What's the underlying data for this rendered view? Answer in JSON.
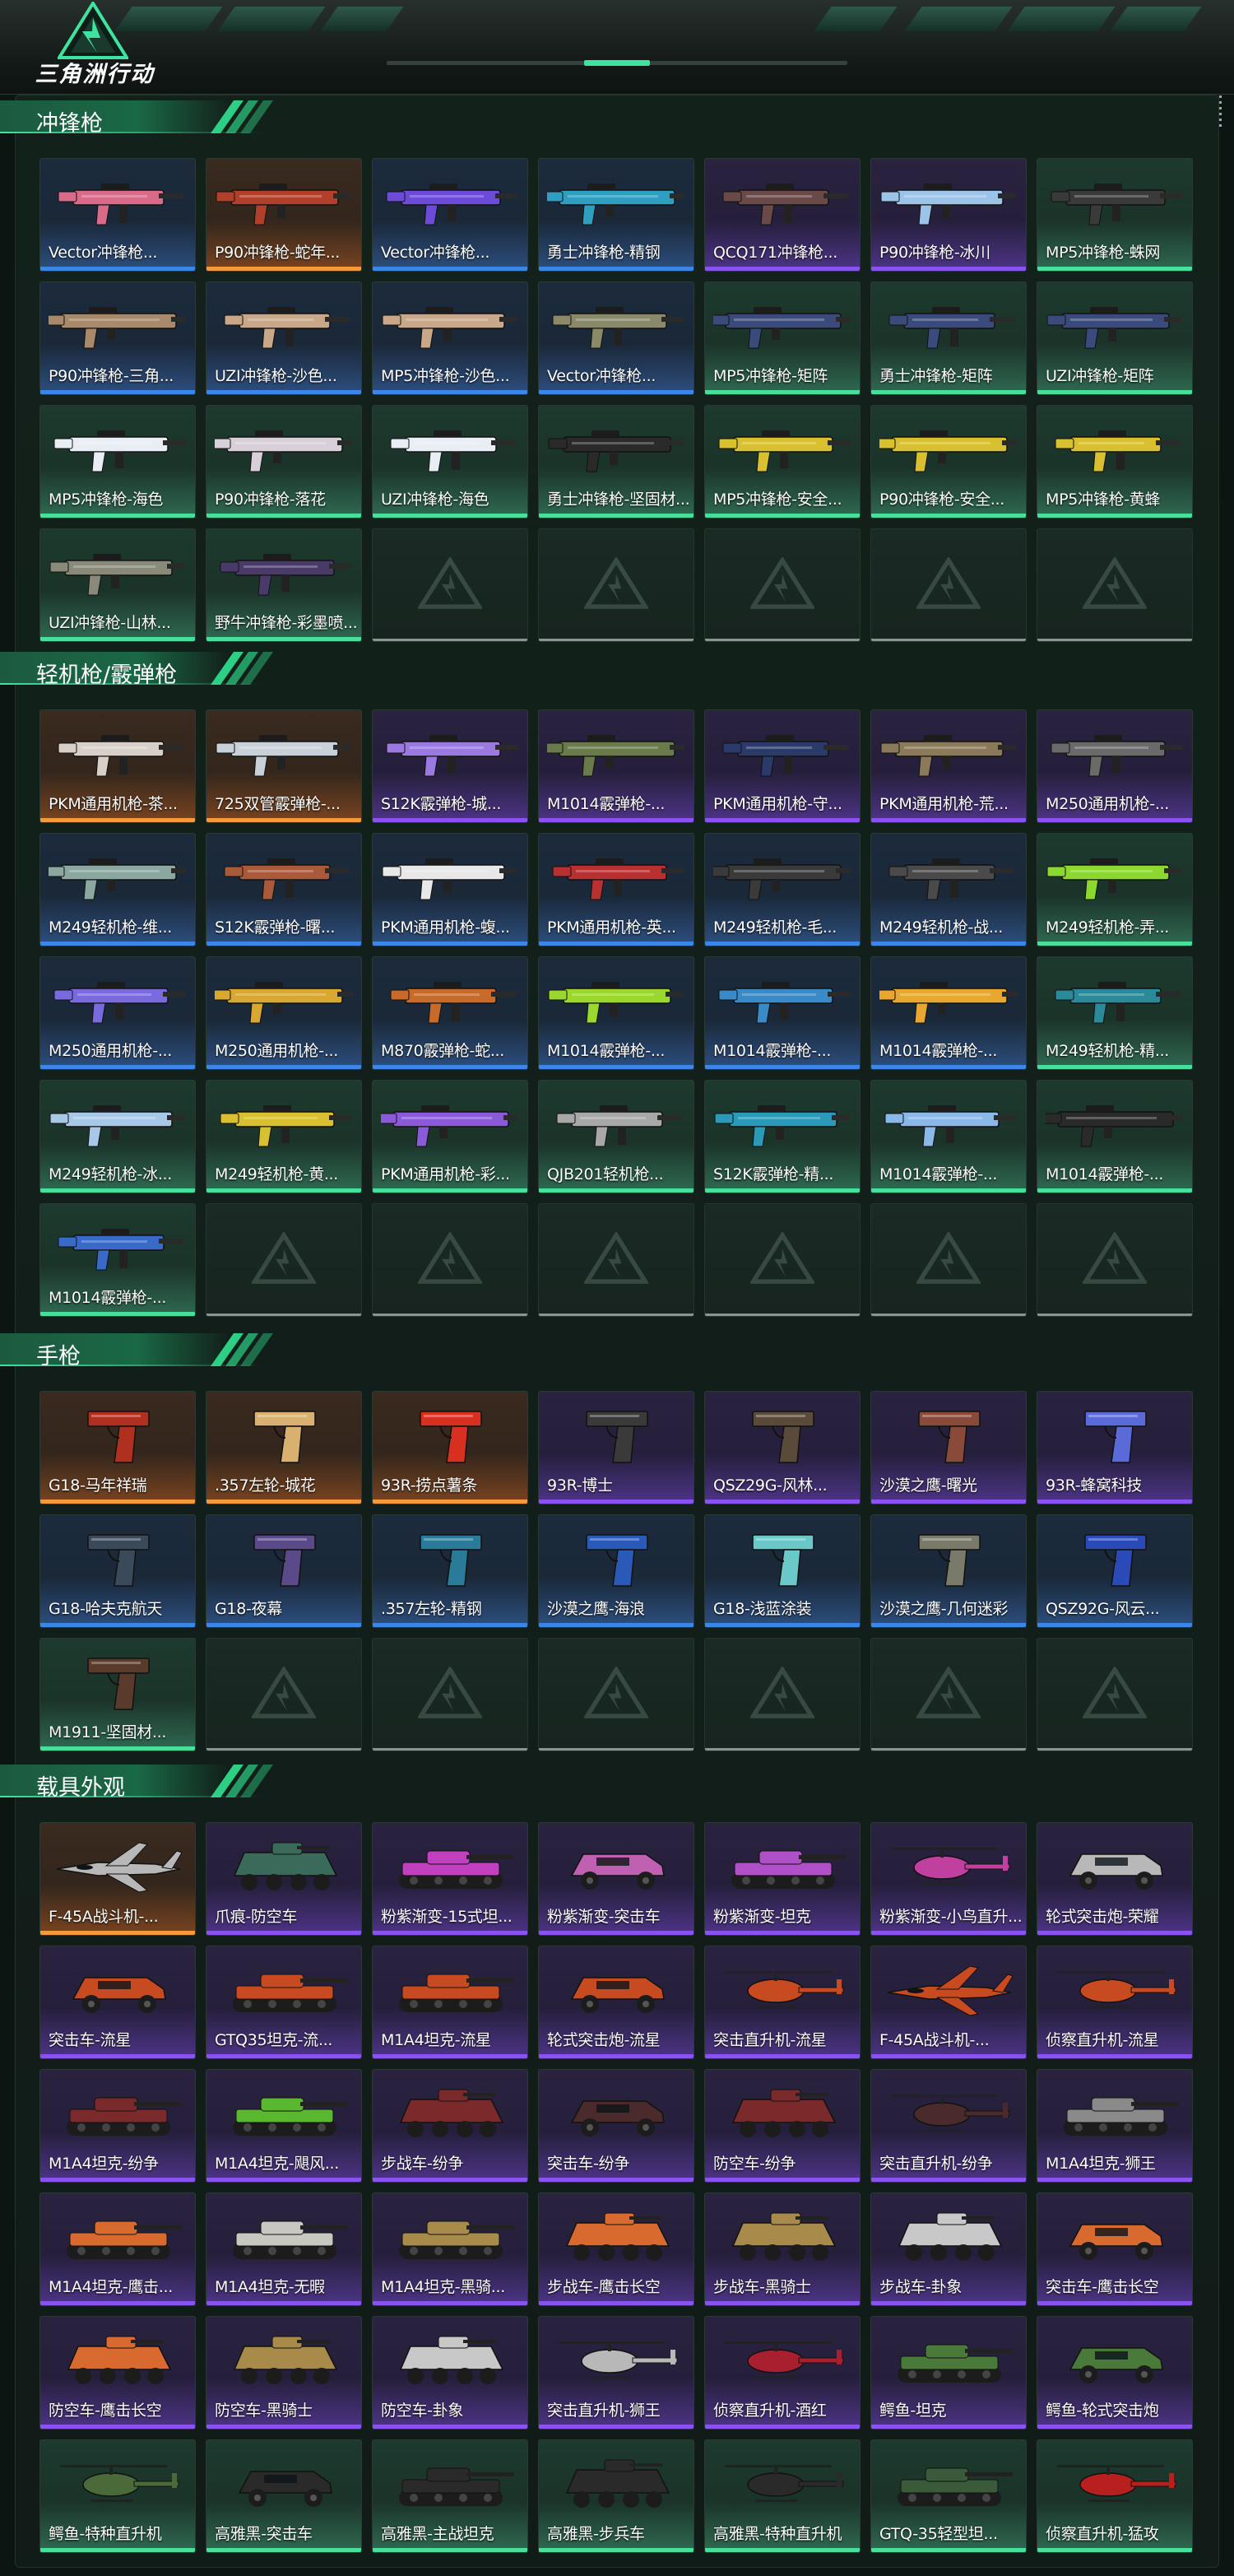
{
  "app": {
    "title": "三角洲行动",
    "logo_icon": "delta-triangle-logo-icon",
    "accent": "#2ccf84"
  },
  "rarity_colors": {
    "green": "#46e09a",
    "blue": "#3b86e8",
    "purple": "#8a52f0",
    "orange": "#f39a3c"
  },
  "sections": [
    {
      "id": "smg",
      "title": "冲锋枪",
      "kind": "gun",
      "items": [
        {
          "label": "Vector冲锋枪...",
          "rarity": "blue",
          "color": "#d86a8a"
        },
        {
          "label": "P90冲锋枪-蛇年...",
          "rarity": "orange",
          "color": "#b0402a"
        },
        {
          "label": "Vector冲锋枪...",
          "rarity": "blue",
          "color": "#6b4bd8"
        },
        {
          "label": "勇士冲锋枪-精钢",
          "rarity": "blue",
          "color": "#2f9ec0"
        },
        {
          "label": "QCQ171冲锋枪...",
          "rarity": "purple",
          "color": "#6a4a48"
        },
        {
          "label": "P90冲锋枪-冰川",
          "rarity": "purple",
          "color": "#9cc3e8"
        },
        {
          "label": "MP5冲锋枪-蛛网",
          "rarity": "green",
          "color": "#3a3a3a"
        },
        {
          "label": "P90冲锋枪-三角...",
          "rarity": "blue",
          "color": "#a88a6a"
        },
        {
          "label": "UZI冲锋枪-沙色...",
          "rarity": "blue",
          "color": "#c8a888"
        },
        {
          "label": "MP5冲锋枪-沙色...",
          "rarity": "blue",
          "color": "#c8a888"
        },
        {
          "label": "Vector冲锋枪...",
          "rarity": "blue",
          "color": "#8a8a6a"
        },
        {
          "label": "MP5冲锋枪-矩阵",
          "rarity": "green",
          "color": "#3a4a7a"
        },
        {
          "label": "勇士冲锋枪-矩阵",
          "rarity": "green",
          "color": "#3a4a7a"
        },
        {
          "label": "UZI冲锋枪-矩阵",
          "rarity": "green",
          "color": "#3a4a7a"
        },
        {
          "label": "MP5冲锋枪-海色",
          "rarity": "green",
          "color": "#e8eef4"
        },
        {
          "label": "P90冲锋枪-落花",
          "rarity": "green",
          "color": "#d8d0d8"
        },
        {
          "label": "UZI冲锋枪-海色",
          "rarity": "green",
          "color": "#e8eef4"
        },
        {
          "label": "勇士冲锋枪-坚固材...",
          "rarity": "green",
          "color": "#2a2a2a"
        },
        {
          "label": "MP5冲锋枪-安全...",
          "rarity": "green",
          "color": "#d8c030"
        },
        {
          "label": "P90冲锋枪-安全...",
          "rarity": "green",
          "color": "#d8c030"
        },
        {
          "label": "MP5冲锋枪-黄蜂",
          "rarity": "green",
          "color": "#d8c030"
        },
        {
          "label": "UZI冲锋枪-山林...",
          "rarity": "green",
          "color": "#8a8a7a"
        },
        {
          "label": "野牛冲锋枪-彩墨喷...",
          "rarity": "green",
          "color": "#4a3a6a"
        },
        {
          "empty": true
        },
        {
          "empty": true
        },
        {
          "empty": true
        },
        {
          "empty": true
        },
        {
          "empty": true
        }
      ]
    },
    {
      "id": "lmg-shotgun",
      "title": "轻机枪/霰弹枪",
      "kind": "gun",
      "items": [
        {
          "label": "PKM通用机枪-茶...",
          "rarity": "orange",
          "color": "#d8d0c8"
        },
        {
          "label": "725双管霰弹枪-...",
          "rarity": "orange",
          "color": "#c8d0d8"
        },
        {
          "label": "S12K霰弹枪-城...",
          "rarity": "purple",
          "color": "#9a7ae0"
        },
        {
          "label": "M1014霰弹枪-...",
          "rarity": "purple",
          "color": "#6a7a4a"
        },
        {
          "label": "PKM通用机枪-守...",
          "rarity": "purple",
          "color": "#2a3a6a"
        },
        {
          "label": "PKM通用机枪-荒...",
          "rarity": "purple",
          "color": "#8a7a5a"
        },
        {
          "label": "M250通用机枪-...",
          "rarity": "purple",
          "color": "#6a6a6a"
        },
        {
          "label": "M249轻机枪-维...",
          "rarity": "blue",
          "color": "#8aa8a0"
        },
        {
          "label": "S12K霰弹枪-曙...",
          "rarity": "blue",
          "color": "#a85a3a"
        },
        {
          "label": "PKM通用机枪-蝮...",
          "rarity": "blue",
          "color": "#e8e8e8"
        },
        {
          "label": "PKM通用机枪-英...",
          "rarity": "blue",
          "color": "#b83030"
        },
        {
          "label": "M249轻机枪-毛...",
          "rarity": "blue",
          "color": "#3a3a3a"
        },
        {
          "label": "M249轻机枪-战...",
          "rarity": "blue",
          "color": "#4a4a4a"
        },
        {
          "label": "M249轻机枪-弄...",
          "rarity": "green",
          "color": "#8ad830"
        },
        {
          "label": "M250通用机枪-...",
          "rarity": "blue",
          "color": "#7a6ae0"
        },
        {
          "label": "M250通用机枪-...",
          "rarity": "blue",
          "color": "#d8a830"
        },
        {
          "label": "M870霰弹枪-蛇...",
          "rarity": "blue",
          "color": "#c86a2a"
        },
        {
          "label": "M1014霰弹枪-...",
          "rarity": "blue",
          "color": "#9ad830"
        },
        {
          "label": "M1014霰弹枪-...",
          "rarity": "blue",
          "color": "#3a8ac8"
        },
        {
          "label": "M1014霰弹枪-...",
          "rarity": "blue",
          "color": "#e8a830"
        },
        {
          "label": "M249轻机枪-精...",
          "rarity": "green",
          "color": "#2a8a9a"
        },
        {
          "label": "M249轻机枪-冰...",
          "rarity": "green",
          "color": "#a8c8e8"
        },
        {
          "label": "M249轻机枪-黄...",
          "rarity": "green",
          "color": "#d8c030"
        },
        {
          "label": "PKM通用机枪-彩...",
          "rarity": "green",
          "color": "#8a5ad8"
        },
        {
          "label": "QJB201轻机枪...",
          "rarity": "green",
          "color": "#a8a8a8"
        },
        {
          "label": "S12K霰弹枪-精...",
          "rarity": "green",
          "color": "#2a9ab8"
        },
        {
          "label": "M1014霰弹枪-...",
          "rarity": "green",
          "color": "#8ab8e8"
        },
        {
          "label": "M1014霰弹枪-...",
          "rarity": "green",
          "color": "#2a2a2a"
        },
        {
          "label": "M1014霰弹枪-...",
          "rarity": "green",
          "color": "#3a6ac8"
        },
        {
          "empty": true
        },
        {
          "empty": true
        },
        {
          "empty": true
        },
        {
          "empty": true
        },
        {
          "empty": true
        },
        {
          "empty": true
        }
      ]
    },
    {
      "id": "pistol",
      "title": "手枪",
      "kind": "pistol",
      "items": [
        {
          "label": "G18-马年祥瑞",
          "rarity": "orange",
          "color": "#b03020"
        },
        {
          "label": ".357左轮-城花",
          "rarity": "orange",
          "color": "#d8b070"
        },
        {
          "label": "93R-捞点薯条",
          "rarity": "orange",
          "color": "#d83020"
        },
        {
          "label": "93R-博士",
          "rarity": "purple",
          "color": "#3a3a3a"
        },
        {
          "label": "QSZ29G-风林...",
          "rarity": "purple",
          "color": "#5a4a3a"
        },
        {
          "label": "沙漠之鹰-曙光",
          "rarity": "purple",
          "color": "#8a4a3a"
        },
        {
          "label": "93R-蜂窝科技",
          "rarity": "purple",
          "color": "#5a6ad8"
        },
        {
          "label": "G18-哈夫克航天",
          "rarity": "blue",
          "color": "#3a4a5a"
        },
        {
          "label": "G18-夜幕",
          "rarity": "blue",
          "color": "#5a4a8a"
        },
        {
          "label": ".357左轮-精钢",
          "rarity": "blue",
          "color": "#2a7a9a"
        },
        {
          "label": "沙漠之鹰-海浪",
          "rarity": "blue",
          "color": "#2a5ab8"
        },
        {
          "label": "G18-浅蓝涂装",
          "rarity": "blue",
          "color": "#6ac8c8"
        },
        {
          "label": "沙漠之鹰-几何迷彩",
          "rarity": "blue",
          "color": "#7a7a6a"
        },
        {
          "label": "QSZ92G-风云...",
          "rarity": "blue",
          "color": "#2a4ab8"
        },
        {
          "label": "M1911-坚固材...",
          "rarity": "green",
          "color": "#5a3a2a"
        },
        {
          "empty": true
        },
        {
          "empty": true
        },
        {
          "empty": true
        },
        {
          "empty": true
        },
        {
          "empty": true
        },
        {
          "empty": true
        }
      ]
    },
    {
      "id": "vehicle",
      "title": "载具外观",
      "kind": "vehicle",
      "items": [
        {
          "label": "F-45A战斗机-...",
          "rarity": "orange",
          "color": "#b8b8b8",
          "v": "jet"
        },
        {
          "label": "爪痕-防空车",
          "rarity": "purple",
          "color": "#3a6a5a",
          "v": "apc"
        },
        {
          "label": "粉紫渐变-15式坦...",
          "rarity": "purple",
          "color": "#c040c0",
          "v": "tank"
        },
        {
          "label": "粉紫渐变-突击车",
          "rarity": "purple",
          "color": "#c060b0",
          "v": "car"
        },
        {
          "label": "粉紫渐变-坦克",
          "rarity": "purple",
          "color": "#b050c8",
          "v": "tank"
        },
        {
          "label": "粉紫渐变-小鸟直升...",
          "rarity": "purple",
          "color": "#c040a0",
          "v": "heli"
        },
        {
          "label": "轮式突击炮-荣耀",
          "rarity": "purple",
          "color": "#b8b8b8",
          "v": "car"
        },
        {
          "label": "突击车-流星",
          "rarity": "purple",
          "color": "#c84a20",
          "v": "car"
        },
        {
          "label": "GTQ35坦克-流...",
          "rarity": "purple",
          "color": "#c84a20",
          "v": "tank"
        },
        {
          "label": "M1A4坦克-流星",
          "rarity": "purple",
          "color": "#c84a20",
          "v": "tank"
        },
        {
          "label": "轮式突击炮-流星",
          "rarity": "purple",
          "color": "#c84a20",
          "v": "car"
        },
        {
          "label": "突击直升机-流星",
          "rarity": "purple",
          "color": "#c84a20",
          "v": "heli"
        },
        {
          "label": "F-45A战斗机-...",
          "rarity": "purple",
          "color": "#c84a20",
          "v": "jet"
        },
        {
          "label": "侦察直升机-流星",
          "rarity": "purple",
          "color": "#c84a20",
          "v": "heli"
        },
        {
          "label": "M1A4坦克-纷争",
          "rarity": "purple",
          "color": "#7a2a2a",
          "v": "tank"
        },
        {
          "label": "M1A4坦克-飓风...",
          "rarity": "purple",
          "color": "#5ab830",
          "v": "tank"
        },
        {
          "label": "步战车-纷争",
          "rarity": "purple",
          "color": "#7a2a2a",
          "v": "apc"
        },
        {
          "label": "突击车-纷争",
          "rarity": "purple",
          "color": "#4a2a2a",
          "v": "car"
        },
        {
          "label": "防空车-纷争",
          "rarity": "purple",
          "color": "#7a2a2a",
          "v": "apc"
        },
        {
          "label": "突击直升机-纷争",
          "rarity": "purple",
          "color": "#4a2a2a",
          "v": "heli"
        },
        {
          "label": "M1A4坦克-狮王",
          "rarity": "purple",
          "color": "#8a8a8a",
          "v": "tank"
        },
        {
          "label": "M1A4坦克-鹰击...",
          "rarity": "purple",
          "color": "#d86a30",
          "v": "tank"
        },
        {
          "label": "M1A4坦克-无暇",
          "rarity": "purple",
          "color": "#c8c8c0",
          "v": "tank"
        },
        {
          "label": "M1A4坦克-黑骑...",
          "rarity": "purple",
          "color": "#a88a4a",
          "v": "tank"
        },
        {
          "label": "步战车-鹰击长空",
          "rarity": "purple",
          "color": "#d86a30",
          "v": "apc"
        },
        {
          "label": "步战车-黑骑士",
          "rarity": "purple",
          "color": "#a88a4a",
          "v": "apc"
        },
        {
          "label": "步战车-卦象",
          "rarity": "purple",
          "color": "#c8c8c8",
          "v": "apc"
        },
        {
          "label": "突击车-鹰击长空",
          "rarity": "purple",
          "color": "#d86a30",
          "v": "car"
        },
        {
          "label": "防空车-鹰击长空",
          "rarity": "purple",
          "color": "#d86a30",
          "v": "apc"
        },
        {
          "label": "防空车-黑骑士",
          "rarity": "purple",
          "color": "#a88a4a",
          "v": "apc"
        },
        {
          "label": "防空车-卦象",
          "rarity": "purple",
          "color": "#c8c8c8",
          "v": "apc"
        },
        {
          "label": "突击直升机-狮王",
          "rarity": "purple",
          "color": "#b8b8b8",
          "v": "heli"
        },
        {
          "label": "侦察直升机-酒红",
          "rarity": "purple",
          "color": "#a82030",
          "v": "heli"
        },
        {
          "label": "鳄鱼-坦克",
          "rarity": "purple",
          "color": "#4a7a3a",
          "v": "tank"
        },
        {
          "label": "鳄鱼-轮式突击炮",
          "rarity": "purple",
          "color": "#4a7a3a",
          "v": "car"
        },
        {
          "label": "鳄鱼-特种直升机",
          "rarity": "green",
          "color": "#4a6a3a",
          "v": "heli"
        },
        {
          "label": "高雅黑-突击车",
          "rarity": "green",
          "color": "#2a2a2a",
          "v": "car"
        },
        {
          "label": "高雅黑-主战坦克",
          "rarity": "green",
          "color": "#2a2a2a",
          "v": "tank"
        },
        {
          "label": "高雅黑-步兵车",
          "rarity": "green",
          "color": "#2a2a2a",
          "v": "apc"
        },
        {
          "label": "高雅黑-特种直升机",
          "rarity": "green",
          "color": "#2a2a2a",
          "v": "heli"
        },
        {
          "label": "GTQ-35轻型坦...",
          "rarity": "green",
          "color": "#3a5a3a",
          "v": "tank"
        },
        {
          "label": "侦察直升机-猛攻",
          "rarity": "green",
          "color": "#b82020",
          "v": "heli"
        }
      ]
    }
  ]
}
